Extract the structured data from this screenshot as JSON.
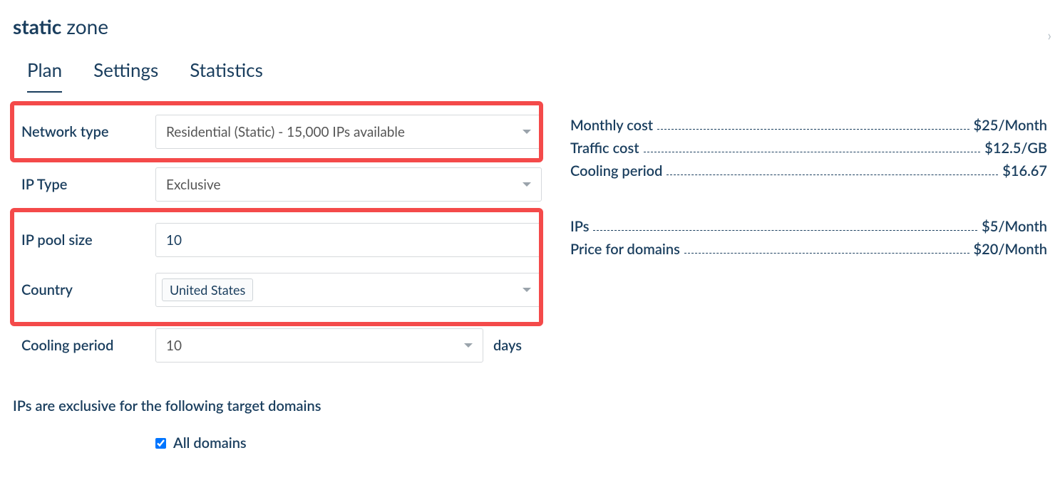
{
  "title": {
    "bold": "static",
    "rest": " zone"
  },
  "tabs": {
    "plan": "Plan",
    "settings": "Settings",
    "statistics": "Statistics"
  },
  "form": {
    "network_type": {
      "label": "Network type",
      "value": "Residential (Static) - 15,000 IPs available"
    },
    "ip_type": {
      "label": "IP Type",
      "value": "Exclusive"
    },
    "ip_pool_size": {
      "label": "IP pool size",
      "value": "10"
    },
    "country": {
      "label": "Country",
      "value": "United States"
    },
    "cooling_period": {
      "label": "Cooling period",
      "value": "10",
      "suffix": "days"
    },
    "domains_heading": "IPs are exclusive for the following target domains",
    "all_domains": "All domains"
  },
  "costs": {
    "monthly": {
      "label": "Monthly cost",
      "value": "$25/Month"
    },
    "traffic": {
      "label": "Traffic cost",
      "value": "$12.5/GB"
    },
    "cooling": {
      "label": "Cooling period",
      "value": "$16.67"
    },
    "ips": {
      "label": "IPs",
      "value": "$5/Month"
    },
    "domains": {
      "label": "Price for domains",
      "value": "$20/Month"
    }
  }
}
